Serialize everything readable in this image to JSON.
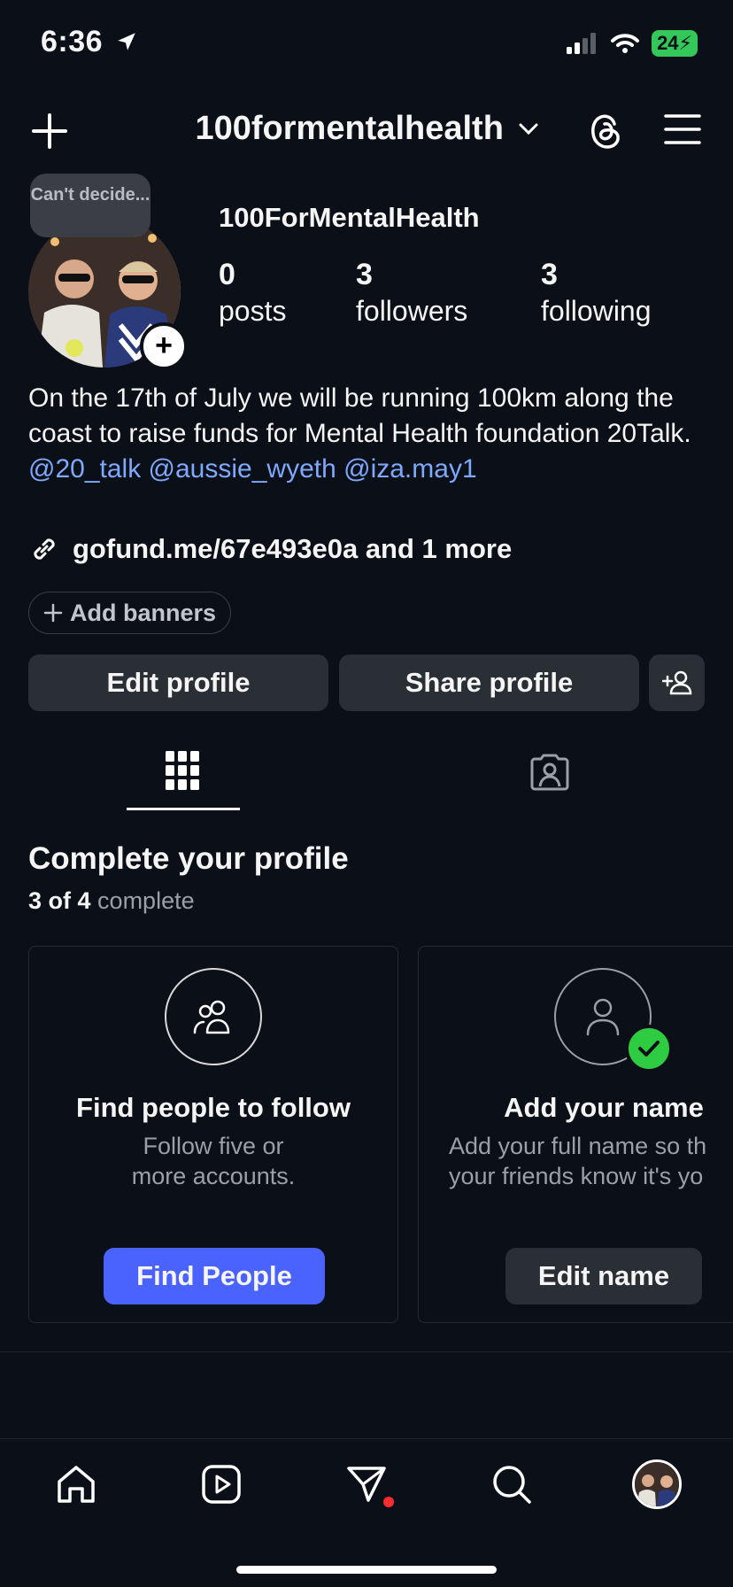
{
  "status_bar": {
    "time": "6:36",
    "battery": "24"
  },
  "header": {
    "username": "100formentalhealth"
  },
  "profile": {
    "note": "Can't decide...",
    "display_name": "100ForMentalHealth",
    "stats": [
      {
        "value": "0",
        "label": "posts"
      },
      {
        "value": "3",
        "label": "followers"
      },
      {
        "value": "3",
        "label": "following"
      }
    ],
    "bio_text": "On the 17th of July we will be running 100km along the coast to raise funds for Mental Health foundation 20Talk.",
    "bio_mentions": [
      "@20_talk",
      "@aussie_wyeth",
      "@iza.may1"
    ],
    "link": "gofund.me/67e493e0a and 1 more",
    "add_banners": "Add banners"
  },
  "actions": {
    "edit_profile": "Edit profile",
    "share_profile": "Share profile"
  },
  "complete_profile": {
    "title": "Complete your profile",
    "progress_bold": "3 of 4",
    "progress_rest": "complete",
    "cards": [
      {
        "title": "Find people to follow",
        "subtitle_line1": "Follow five or",
        "subtitle_line2": "more accounts.",
        "button": "Find People"
      },
      {
        "title": "Add your name",
        "subtitle_line1": "Add your full name so th",
        "subtitle_line2": "your friends know it's yo",
        "button": "Edit name"
      }
    ]
  },
  "colors": {
    "accent": "#4a63ff",
    "mention": "#7fa8ff",
    "background": "#0b0f17",
    "check": "#2ecc40"
  }
}
